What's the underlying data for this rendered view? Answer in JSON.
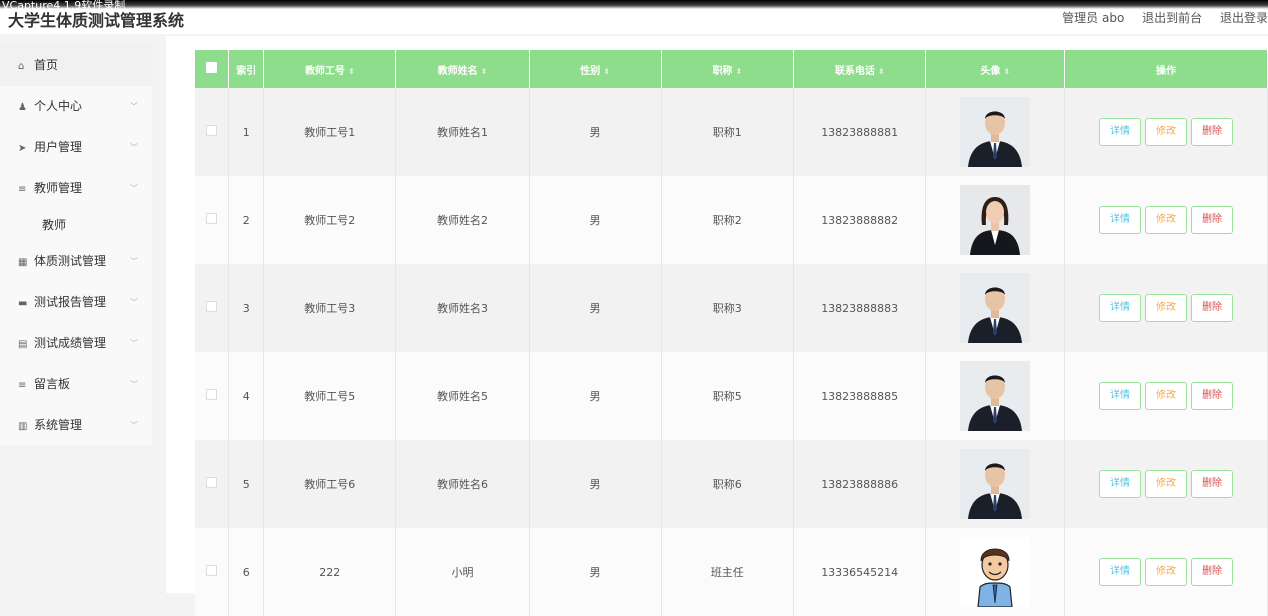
{
  "watermark": "VCapture4.1.9软件录制",
  "app_title": "大学生体质测试管理系统",
  "top_links": [
    "管理员 abo",
    "退出到前台",
    "退出登录"
  ],
  "sidebar": {
    "items": [
      {
        "label": "首页",
        "icon": "home-icon"
      },
      {
        "label": "个人中心",
        "icon": "user-icon"
      },
      {
        "label": "用户管理",
        "icon": "send-icon"
      },
      {
        "label": "教师管理",
        "icon": "menu-icon",
        "sub": "教师"
      },
      {
        "label": "体质测试管理",
        "icon": "grid-icon"
      },
      {
        "label": "测试报告管理",
        "icon": "monitor-icon"
      },
      {
        "label": "测试成绩管理",
        "icon": "document-icon"
      },
      {
        "label": "留言板",
        "icon": "menu-icon"
      },
      {
        "label": "系统管理",
        "icon": "chart-icon"
      }
    ]
  },
  "table": {
    "headers": [
      "索引",
      "教师工号",
      "教师姓名",
      "性别",
      "职称",
      "联系电话",
      "头像",
      "操作"
    ],
    "actions": {
      "detail": "详情",
      "edit": "修改",
      "delete": "删除"
    },
    "rows": [
      {
        "index": "1",
        "id": "教师工号1",
        "name": "教师姓名1",
        "gender": "男",
        "title": "职称1",
        "phone": "13823888881",
        "avatar": "man-suit-photo"
      },
      {
        "index": "2",
        "id": "教师工号2",
        "name": "教师姓名2",
        "gender": "男",
        "title": "职称2",
        "phone": "13823888882",
        "avatar": "woman-suit-photo"
      },
      {
        "index": "3",
        "id": "教师工号3",
        "name": "教师姓名3",
        "gender": "男",
        "title": "职称3",
        "phone": "13823888883",
        "avatar": "man-suit-photo"
      },
      {
        "index": "4",
        "id": "教师工号5",
        "name": "教师姓名5",
        "gender": "男",
        "title": "职称5",
        "phone": "13823888885",
        "avatar": "man-suit-photo"
      },
      {
        "index": "5",
        "id": "教师工号6",
        "name": "教师姓名6",
        "gender": "男",
        "title": "职称6",
        "phone": "13823888886",
        "avatar": "man-suit-photo"
      },
      {
        "index": "6",
        "id": "222",
        "name": "小明",
        "gender": "男",
        "title": "班主任",
        "phone": "13336545214",
        "avatar": "cartoon-man"
      }
    ]
  }
}
